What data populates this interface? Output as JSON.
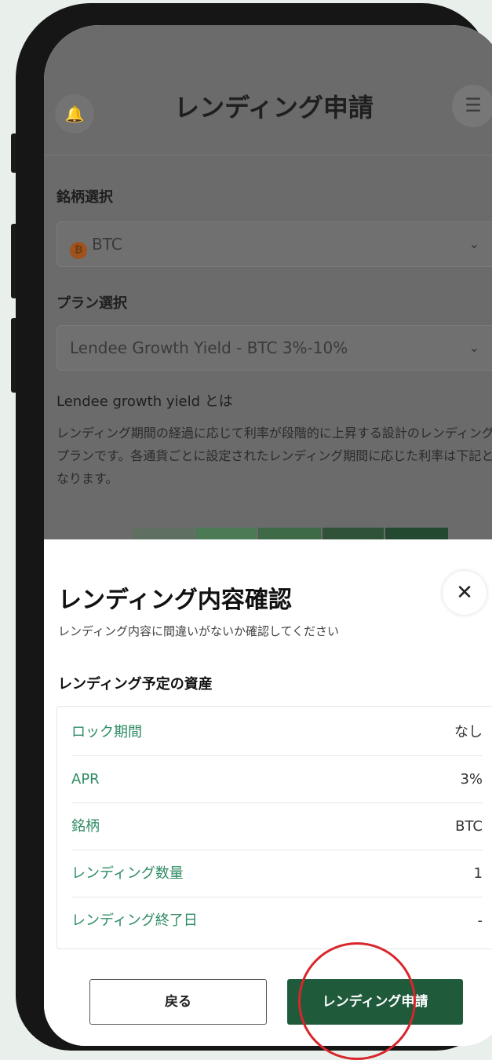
{
  "background_app": {
    "title": "レンディング申請",
    "bell_icon": "bell-icon",
    "menu_icon": "hamburger-menu-icon",
    "asset_label": "銘柄選択",
    "asset_value": "BTC",
    "asset_icon_glyph": "₿",
    "plan_label": "プラン選択",
    "plan_value": "Lendee Growth Yield - BTC 3%-10%",
    "about_heading": "Lendee growth yield とは",
    "about_text": "レンディング期間の経過に応じて利率が段階的に上昇する設計のレンディングプランです。各通貨ごとに設定されたレンディング期間に応じた利率は下記となります。"
  },
  "sheet": {
    "title": "レンディング内容確認",
    "subtitle": "レンディング内容に間違いがないか確認してください",
    "section_label": "レンディング予定の資産",
    "close_glyph": "✕",
    "rows": [
      {
        "key": "ロック期間",
        "value": "なし"
      },
      {
        "key": "APR",
        "value": "3%"
      },
      {
        "key": "銘柄",
        "value": "BTC"
      },
      {
        "key": "レンディング数量",
        "value": "1"
      },
      {
        "key": "レンディング終了日",
        "value": "-"
      }
    ],
    "back_label": "戻る",
    "apply_label": "レンディング申請"
  },
  "colors": {
    "accent_green": "#1f5a3b",
    "label_green": "#2e8b63",
    "highlight_circle": "#d8262c"
  }
}
